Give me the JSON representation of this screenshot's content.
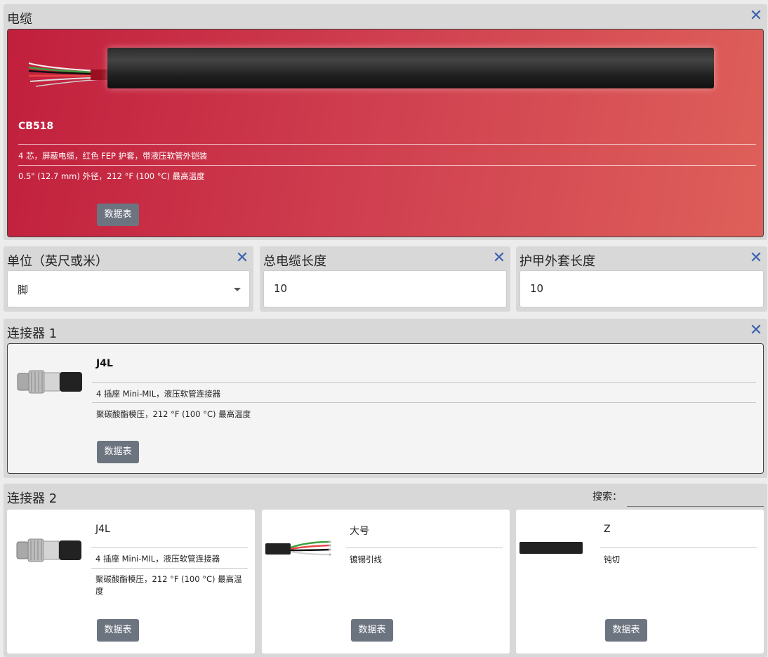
{
  "cable": {
    "title": "电缆",
    "close_icon": "close-icon",
    "part": "CB518",
    "desc1": "4 芯，屏蔽电缆，红色 FEP 护套，带液压软管外铠装",
    "desc2": "0.5\" (12.7 mm) 外径，212 °F (100 °C) 最高温度",
    "datasheet": "数据表"
  },
  "fields": [
    {
      "label": "单位（英尺或米）",
      "value": "脚"
    },
    {
      "label": "总电缆长度",
      "value": "10"
    },
    {
      "label": "护甲外套长度",
      "value": "10"
    }
  ],
  "connector1": {
    "title": "连接器 1",
    "part": "J4L",
    "desc1": "4 插座 Mini-MIL，液压软管连接器",
    "desc2": "聚碳酸酯模压，212 °F (100 °C) 最高温度",
    "datasheet": "数据表"
  },
  "connector2": {
    "title": "连接器 2",
    "search_label": "搜索：",
    "options": [
      {
        "title": "J4L",
        "desc1": "4 插座 Mini-MIL，液压软管连接器",
        "desc2": "聚碳酸酯模压，212 °F (100 °C) 最高温度",
        "datasheet": "数据表"
      },
      {
        "title": "大号",
        "desc1": "镀锡引线",
        "datasheet": "数据表"
      },
      {
        "title": "Z",
        "desc1": "钝切",
        "datasheet": "数据表"
      }
    ]
  },
  "colors": {
    "accent_red": "#c8283f",
    "close_blue": "#3a5fb0",
    "button_grey": "#6c7480"
  }
}
